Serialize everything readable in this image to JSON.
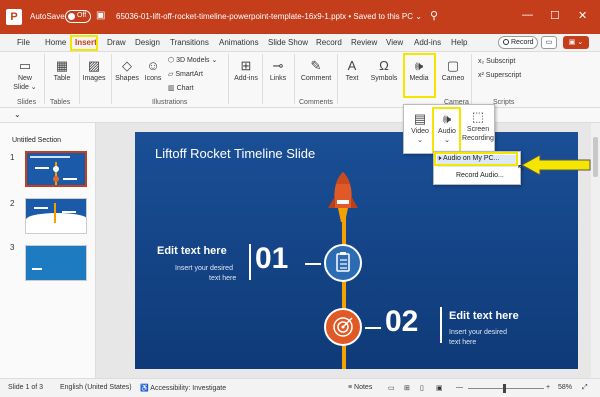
{
  "titlebar": {
    "autosave_label": "AutoSave",
    "autosave_state": "Off",
    "document_title": "65036-01-lift-off-rocket-timeline-powerpoint-template-16x9-1.pptx  •  Saved to this PC ⌄",
    "accent_color": "#c43e1c"
  },
  "menu": {
    "tabs": [
      "File",
      "Home",
      "Insert",
      "Draw",
      "Design",
      "Transitions",
      "Animations",
      "Slide Show",
      "Record",
      "Review",
      "View",
      "Add-ins",
      "Help"
    ],
    "active_tab": "Insert",
    "record_label": "Record"
  },
  "ribbon": {
    "new_slide": "New Slide ⌄",
    "table": "Table",
    "images": "Images",
    "shapes": "Shapes",
    "icons": "Icons",
    "models": "3D Models",
    "smartart": "SmartArt",
    "chart": "Chart",
    "addins": "Add-ins",
    "links": "Links",
    "comment": "Comment",
    "text": "Text",
    "symbols": "Symbols",
    "media": "Media",
    "cameo": "Cameo",
    "subscript": "Subscript",
    "superscript": "Superscript",
    "groups": {
      "slides": "Slides",
      "tables": "Tables",
      "illustrations": "Illustrations",
      "comments": "Comments",
      "camera": "Camera",
      "scripts": "Scripts"
    }
  },
  "media_dropdown": {
    "video": "Video",
    "audio": "Audio",
    "screen_recording": "Screen Recording"
  },
  "audio_menu": {
    "audio_on_pc": "Audio on My PC...",
    "record_audio": "Record Audio..."
  },
  "thumbnails": {
    "section": "Untitled Section",
    "numbers": [
      "1",
      "2",
      "3"
    ]
  },
  "slide": {
    "title": "Liftoff Rocket Timeline Slide",
    "item1": {
      "heading": "Edit text here",
      "body_line1": "Insert your desired",
      "body_line2": "text here",
      "number": "01"
    },
    "item2": {
      "heading": "Edit text here",
      "body_line1": "Insert your desired",
      "body_line2": "text here",
      "number": "02"
    }
  },
  "status": {
    "slide_of": "Slide 1 of 3",
    "language": "English (United States)",
    "accessibility": "Accessibility: Investigate",
    "notes": "Notes",
    "zoom": "58%"
  },
  "colors": {
    "highlight": "#f5e600",
    "slide_blue": "#1a4f96",
    "timeline_orange": "#f5a200"
  }
}
